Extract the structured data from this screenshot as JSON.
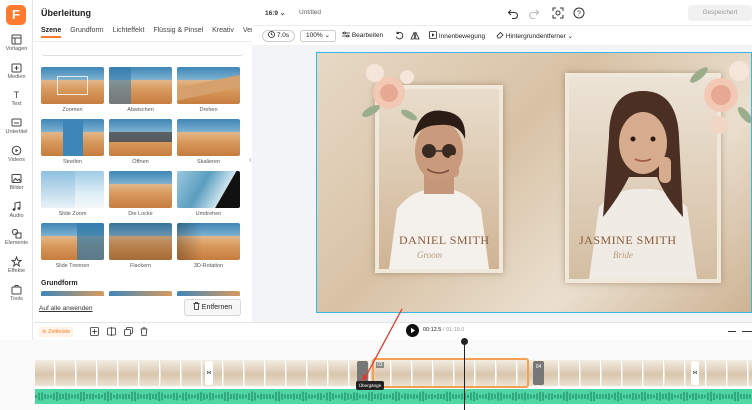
{
  "app": {
    "logo_letter": "F",
    "brand_color": "#ff7a2f"
  },
  "rail": {
    "items": [
      {
        "label": "Vorlagen",
        "icon": "templates-icon"
      },
      {
        "label": "Medien",
        "icon": "media-icon"
      },
      {
        "label": "Text",
        "icon": "text-icon"
      },
      {
        "label": "Untertitel",
        "icon": "subtitles-icon"
      },
      {
        "label": "Videos",
        "icon": "videos-icon"
      },
      {
        "label": "Bilder",
        "icon": "images-icon"
      },
      {
        "label": "Audio",
        "icon": "audio-icon"
      },
      {
        "label": "Elemente",
        "icon": "elements-icon"
      },
      {
        "label": "Effekte",
        "icon": "effects-icon"
      },
      {
        "label": "Tools",
        "icon": "tools-icon"
      }
    ]
  },
  "panel": {
    "title": "Überleitung",
    "tabs": [
      "Szene",
      "Grundform",
      "Lichteffekt",
      "Flüssig & Pinsel",
      "Kreativ",
      "Ver"
    ],
    "active_tab": "Szene",
    "transitions": [
      "Zoomen",
      "Abwischen",
      "Drehen",
      "Streifen",
      "Öffnen",
      "Skalieren",
      "Slide Zoom",
      "Die Locke",
      "Umdrehen",
      "Slide Trennen",
      "Flackern",
      "3D-Rotation"
    ],
    "section_title": "Grundform",
    "apply_all": "Auf alle anwenden",
    "remove": "Entfernen"
  },
  "topbar": {
    "ratio": "16:9",
    "project_name": "Untitled",
    "saved": "Gespeichert"
  },
  "toolbar": {
    "duration": "7.0s",
    "zoom": "100%",
    "edit": "Bearbeiten",
    "inner_motion": "Innenbewegung",
    "bg_remover": "Hintergrundentferner"
  },
  "preview": {
    "left_name": "DANIEL SMITH",
    "left_script": "Groom",
    "right_name": "JASMINE SMITH",
    "right_script": "Bride"
  },
  "timeline": {
    "mode": "Zeitleiste",
    "current_time": "00:12.5",
    "separator": "/",
    "total_time": "01:19.0",
    "clip_numbers": [
      "03",
      "04"
    ],
    "tooltip": "Übergänge",
    "audio_color": "#4fd6a4",
    "selection_color": "#f5a052"
  }
}
